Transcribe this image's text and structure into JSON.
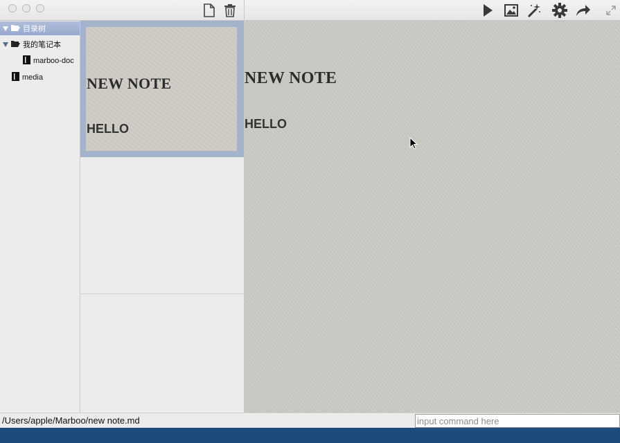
{
  "toolbar": {
    "left_tools": [
      "new-document-icon",
      "trash-icon"
    ],
    "right_tools": [
      "play-icon",
      "image-icon",
      "magic-wand-icon",
      "gear-icon",
      "share-arrow-icon",
      "fullscreen-icon"
    ]
  },
  "sidebar": {
    "items": [
      {
        "label": "目录树",
        "icon": "folder-open-icon",
        "expanded": true,
        "selected": true
      },
      {
        "label": "我的笔记本",
        "icon": "folder-open-icon",
        "expanded": true,
        "selected": false
      },
      {
        "label": "marboo-doc",
        "icon": "notebook-icon",
        "selected": false
      },
      {
        "label": "media",
        "icon": "notebook-icon",
        "selected": false
      }
    ]
  },
  "note_list": {
    "cards": [
      {
        "title": "NEW NOTE",
        "subtitle": "HELLO",
        "selected": true
      }
    ]
  },
  "preview": {
    "title": "NEW NOTE",
    "subtitle": "HELLO"
  },
  "statusbar": {
    "path": "/Users/apple/Marboo/new note.md",
    "command_placeholder": "input command here",
    "command_value": ""
  },
  "colors": {
    "selection": "#a4b2cc",
    "paper": "#cbc9c3",
    "chrome": "#ececec"
  }
}
